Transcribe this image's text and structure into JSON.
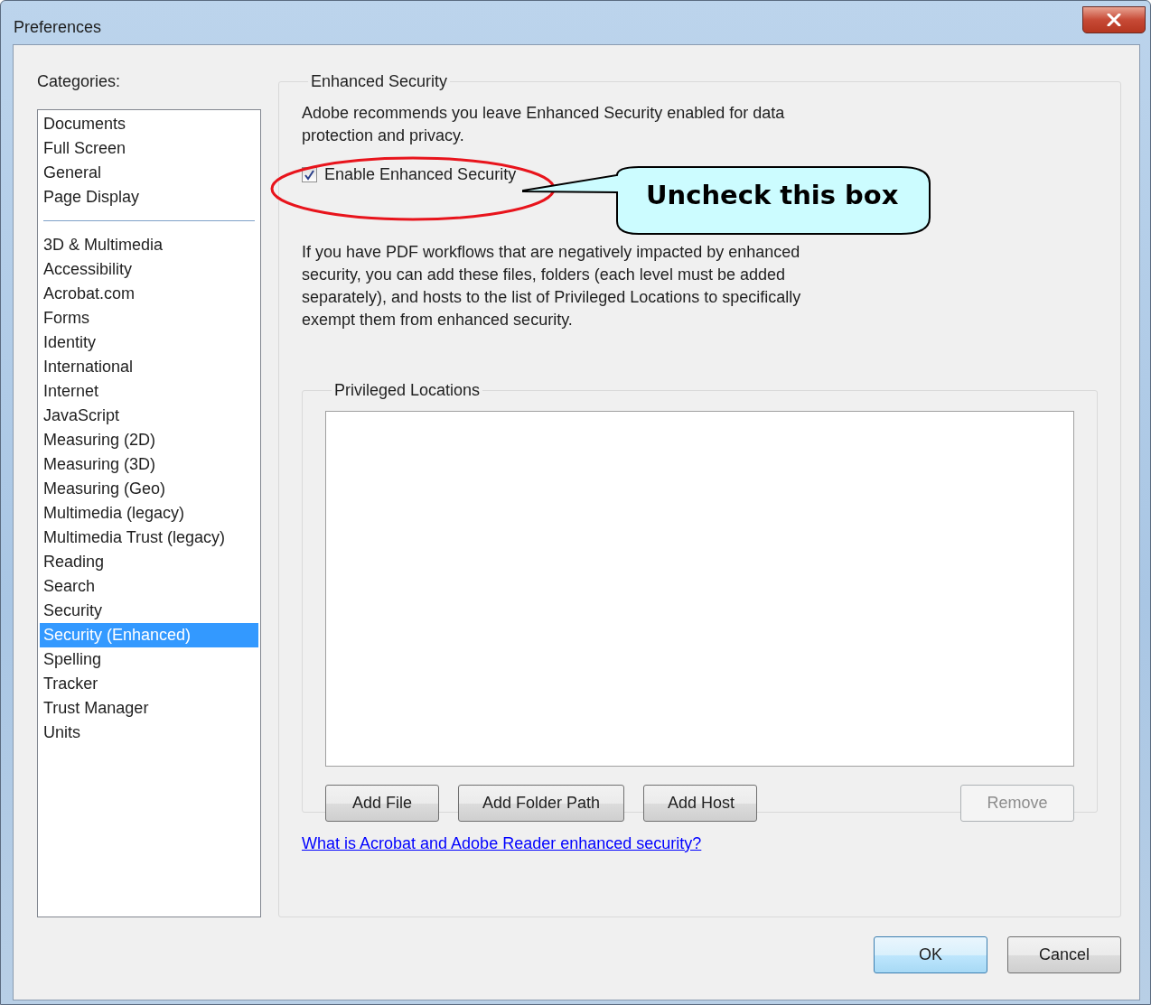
{
  "window": {
    "title": "Preferences"
  },
  "categories": {
    "label": "Categories:",
    "groups": [
      {
        "items": [
          {
            "label": "Documents",
            "selected": false
          },
          {
            "label": "Full Screen",
            "selected": false
          },
          {
            "label": "General",
            "selected": false
          },
          {
            "label": "Page Display",
            "selected": false
          }
        ]
      },
      {
        "items": [
          {
            "label": "3D & Multimedia",
            "selected": false
          },
          {
            "label": "Accessibility",
            "selected": false
          },
          {
            "label": "Acrobat.com",
            "selected": false
          },
          {
            "label": "Forms",
            "selected": false
          },
          {
            "label": "Identity",
            "selected": false
          },
          {
            "label": "International",
            "selected": false
          },
          {
            "label": "Internet",
            "selected": false
          },
          {
            "label": "JavaScript",
            "selected": false
          },
          {
            "label": "Measuring (2D)",
            "selected": false
          },
          {
            "label": "Measuring (3D)",
            "selected": false
          },
          {
            "label": "Measuring (Geo)",
            "selected": false
          },
          {
            "label": "Multimedia (legacy)",
            "selected": false
          },
          {
            "label": "Multimedia Trust (legacy)",
            "selected": false
          },
          {
            "label": "Reading",
            "selected": false
          },
          {
            "label": "Search",
            "selected": false
          },
          {
            "label": "Security",
            "selected": false
          },
          {
            "label": "Security (Enhanced)",
            "selected": true
          },
          {
            "label": "Spelling",
            "selected": false
          },
          {
            "label": "Tracker",
            "selected": false
          },
          {
            "label": "Trust Manager",
            "selected": false
          },
          {
            "label": "Units",
            "selected": false
          }
        ]
      }
    ]
  },
  "enhanced_security": {
    "title": "Enhanced Security",
    "intro": "Adobe recommends you leave Enhanced Security enabled for data protection and privacy.",
    "checkbox": {
      "label": "Enable Enhanced Security",
      "checked": true
    },
    "note": "If you have PDF workflows that are negatively impacted by enhanced security, you can add these files, folders (each level must be added separately), and hosts to the list of Privileged Locations to specifically exempt them from enhanced security.",
    "privileged_locations": {
      "title": "Privileged Locations",
      "buttons": [
        {
          "label": "Add File",
          "disabled": false
        },
        {
          "label": "Add Folder Path",
          "disabled": false
        },
        {
          "label": "Add Host",
          "disabled": false
        },
        {
          "label": "Remove",
          "disabled": true
        }
      ]
    },
    "link": "What is Acrobat and Adobe Reader enhanced security?"
  },
  "annotation": {
    "text": "Uncheck this box"
  },
  "buttons": [
    {
      "label": "OK",
      "default": true
    },
    {
      "label": "Cancel",
      "default": false
    }
  ]
}
